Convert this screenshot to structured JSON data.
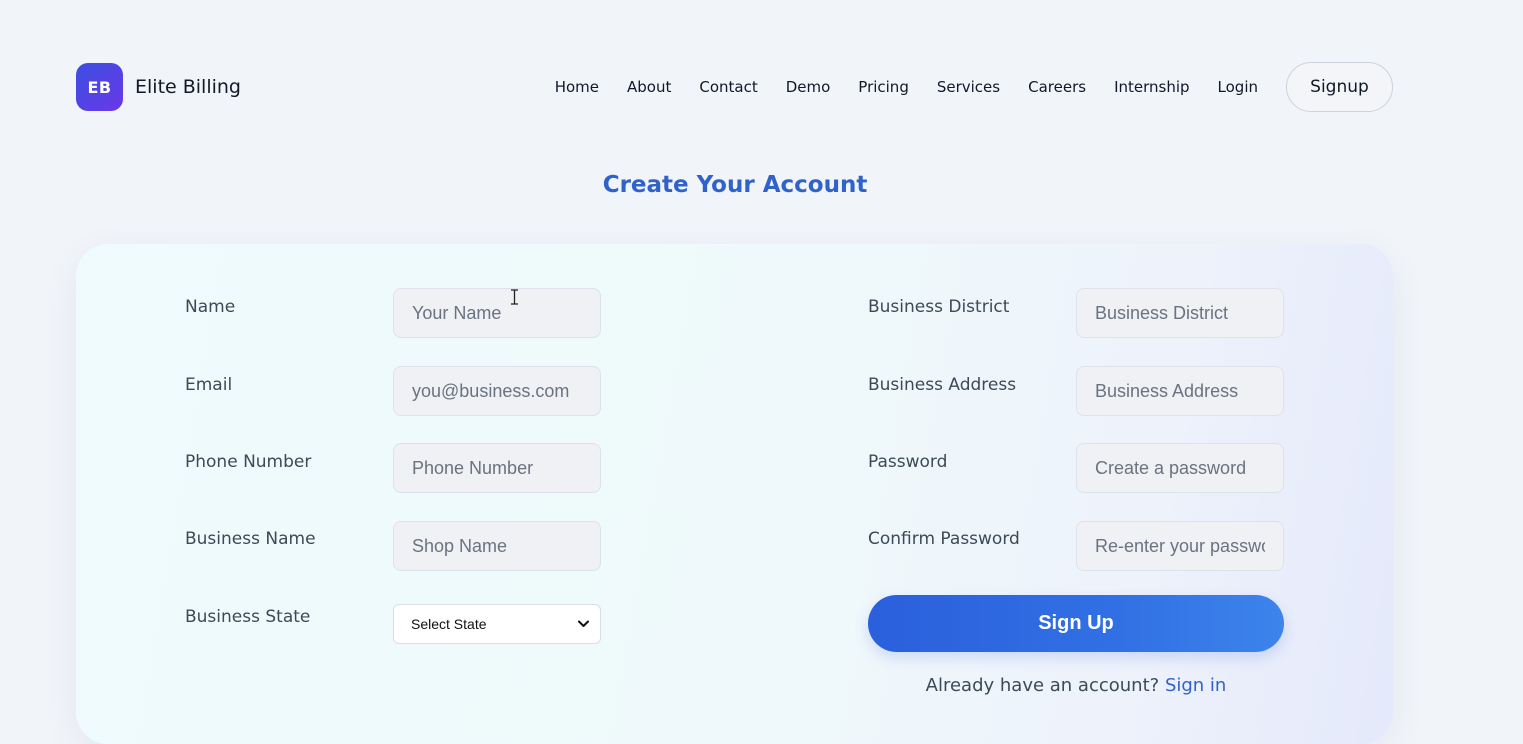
{
  "brand": {
    "badge": "EB",
    "name": "Elite Billing"
  },
  "nav": {
    "items": [
      "Home",
      "About",
      "Contact",
      "Demo",
      "Pricing",
      "Services",
      "Careers",
      "Internship",
      "Login"
    ],
    "signup_label": "Signup"
  },
  "page_title": "Create Your Account",
  "form": {
    "left": [
      {
        "label": "Name",
        "placeholder": "Your Name"
      },
      {
        "label": "Email",
        "placeholder": "you@business.com"
      },
      {
        "label": "Phone Number",
        "placeholder": "Phone Number"
      },
      {
        "label": "Business Name",
        "placeholder": "Shop Name"
      }
    ],
    "state": {
      "label": "Business State",
      "selected": "Select State"
    },
    "right": [
      {
        "label": "Business District",
        "placeholder": "Business District"
      },
      {
        "label": "Business Address",
        "placeholder": "Business Address"
      },
      {
        "label": "Password",
        "placeholder": "Create a password"
      },
      {
        "label": "Confirm Password",
        "placeholder": "Re-enter your password"
      }
    ],
    "submit_label": "Sign Up",
    "signin_prompt": "Already have an account?",
    "signin_link": "Sign in"
  },
  "colors": {
    "accent": "#2f63c9",
    "button": "#2b5fdc",
    "background": "#f1f4f9"
  }
}
